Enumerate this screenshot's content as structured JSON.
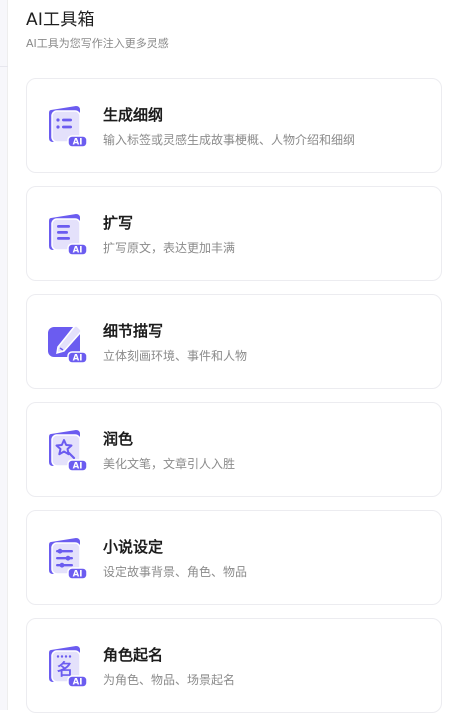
{
  "header": {
    "title": "AI工具箱",
    "subtitle": "AI工具为您写作注入更多灵感"
  },
  "tools": [
    {
      "title": "生成细纲",
      "description": "输入标签或灵感生成故事梗概、人物介绍和细纲",
      "icon": "outline-list-icon"
    },
    {
      "title": "扩写",
      "description": "扩写原文，表达更加丰满",
      "icon": "expand-lines-icon"
    },
    {
      "title": "细节描写",
      "description": "立体刻画环境、事件和人物",
      "icon": "pencil-edit-icon"
    },
    {
      "title": "润色",
      "description": "美化文笔，文章引人入胜",
      "icon": "polish-star-icon"
    },
    {
      "title": "小说设定",
      "description": "设定故事背景、角色、物品",
      "icon": "settings-sliders-icon"
    },
    {
      "title": "角色起名",
      "description": "为角色、物品、场景起名",
      "icon": "name-character-icon"
    }
  ],
  "badge_label": "AI",
  "colors": {
    "accent": "#6b5cf0",
    "accent_light": "#dcd8fb",
    "card_border": "#ececf0"
  }
}
